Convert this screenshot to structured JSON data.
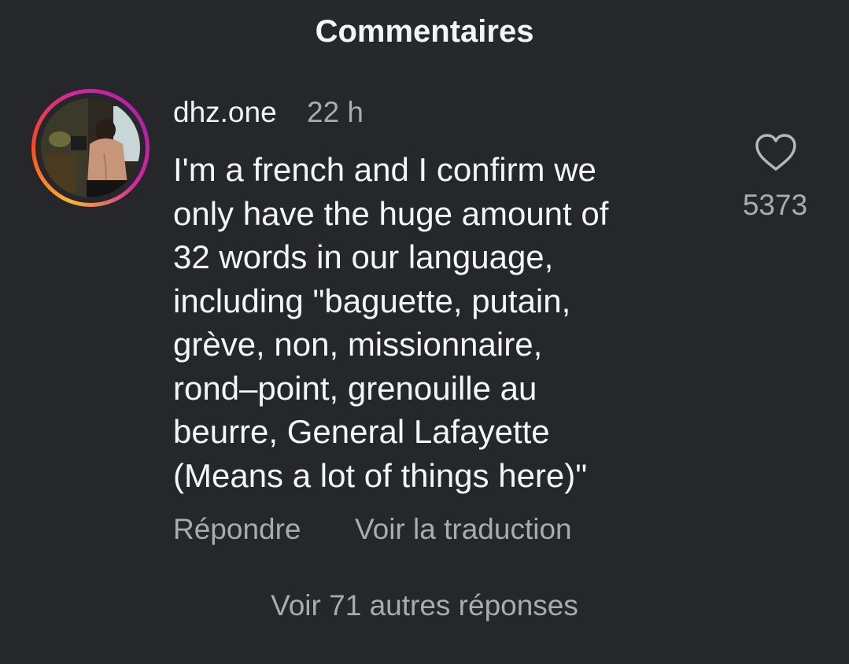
{
  "header": {
    "title": "Commentaires"
  },
  "comment": {
    "username": "dhz.one",
    "timestamp": "22 h",
    "text_lines": [
      "I'm a french and I confirm we",
      "only have the huge amount of",
      "32 words in our language,",
      "including \"baguette, putain,",
      "grève, non, missionnaire,",
      "rond–point, grenouille au",
      "beurre, General Lafayette",
      "(Means a lot of things here)\""
    ],
    "like_count": "5373",
    "like_icon": "heart-outline-icon",
    "reply_label": "Répondre",
    "translate_label": "Voir la traduction"
  },
  "replies": {
    "more_label": "Voir 71 autres réponses"
  },
  "colors": {
    "background": "#25272b",
    "primary_text": "#f4f5f7",
    "secondary_text": "#a8abb1",
    "story_ring_start": "#f7b733",
    "story_ring_end": "#d6249f"
  }
}
